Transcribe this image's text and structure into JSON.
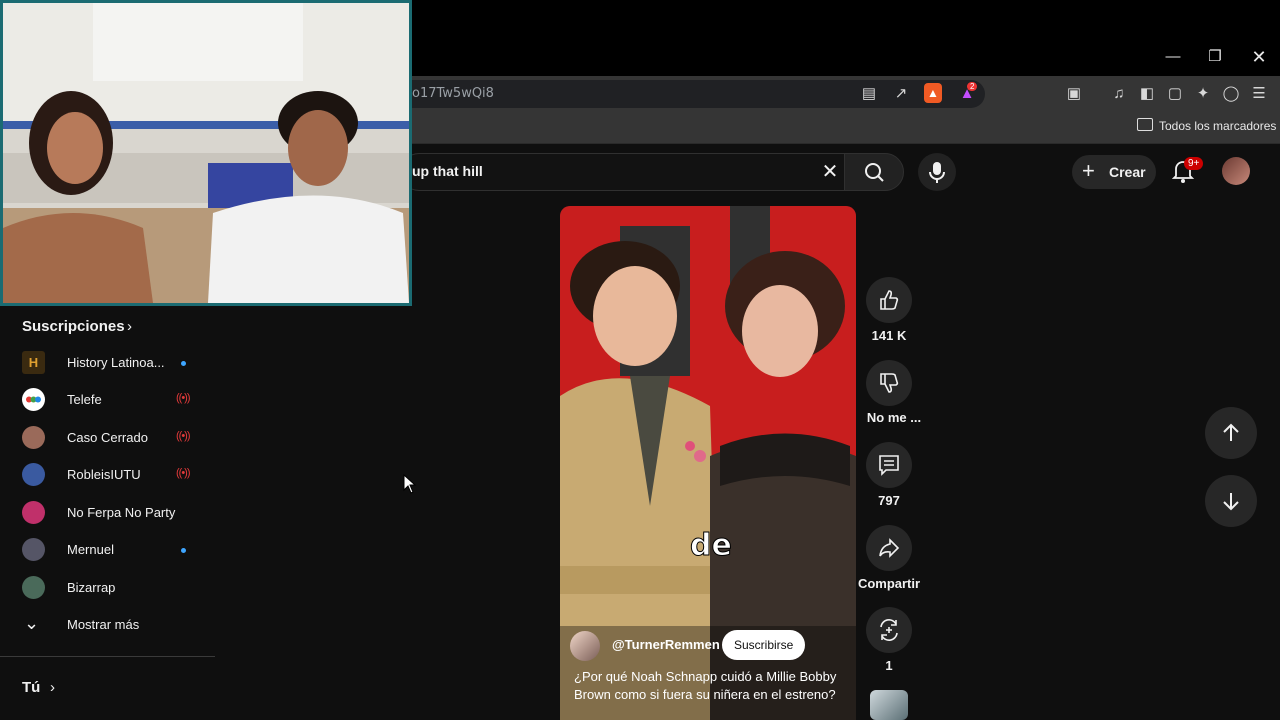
{
  "browser": {
    "url": "o17Tw5wQi8",
    "bookmarks_all_label": "Todos los marcadores",
    "window_controls": [
      "minimize",
      "restore",
      "close"
    ],
    "extension_badge": "2"
  },
  "masthead": {
    "search_value": "up that hill",
    "create_label": "Crear",
    "notifications_badge": "9+"
  },
  "sidebar": {
    "subscriptions_title": "Suscripciones",
    "channels": [
      {
        "name": "History Latinoa...",
        "indicator": "dot",
        "avatar_color": "#3a2a10"
      },
      {
        "name": "Telefe",
        "indicator": "live",
        "avatar_color": "#ffffff"
      },
      {
        "name": "Caso Cerrado",
        "indicator": "live",
        "avatar_color": "#9a6a5a"
      },
      {
        "name": "RobleisIUTU",
        "indicator": "live",
        "avatar_color": "#3a5aa0"
      },
      {
        "name": "No Ferpa No Party",
        "indicator": "none",
        "avatar_color": "#c0306a"
      },
      {
        "name": "Mernuel",
        "indicator": "dot",
        "avatar_color": "#555566"
      },
      {
        "name": "Bizarrap",
        "indicator": "none",
        "avatar_color": "#4a6a5a"
      }
    ],
    "show_more_label": "Mostrar más",
    "you_title": "Tú"
  },
  "short": {
    "caption_word": "de",
    "channel_handle": "@TurnerRemmen",
    "subscribe_label": "Suscribirse",
    "title": "¿Por qué Noah Schnapp cuidó a Millie Bobby Brown como si fuera su niñera en el estreno?"
  },
  "actions": {
    "likes": "141 K",
    "dislike_label": "No me ...",
    "comments": "797",
    "share_label": "Compartir",
    "remix_count": "1"
  },
  "colors": {
    "background": "#0f0f0f",
    "accent_red": "#cc0000",
    "link_blue": "#3ea6ff"
  }
}
